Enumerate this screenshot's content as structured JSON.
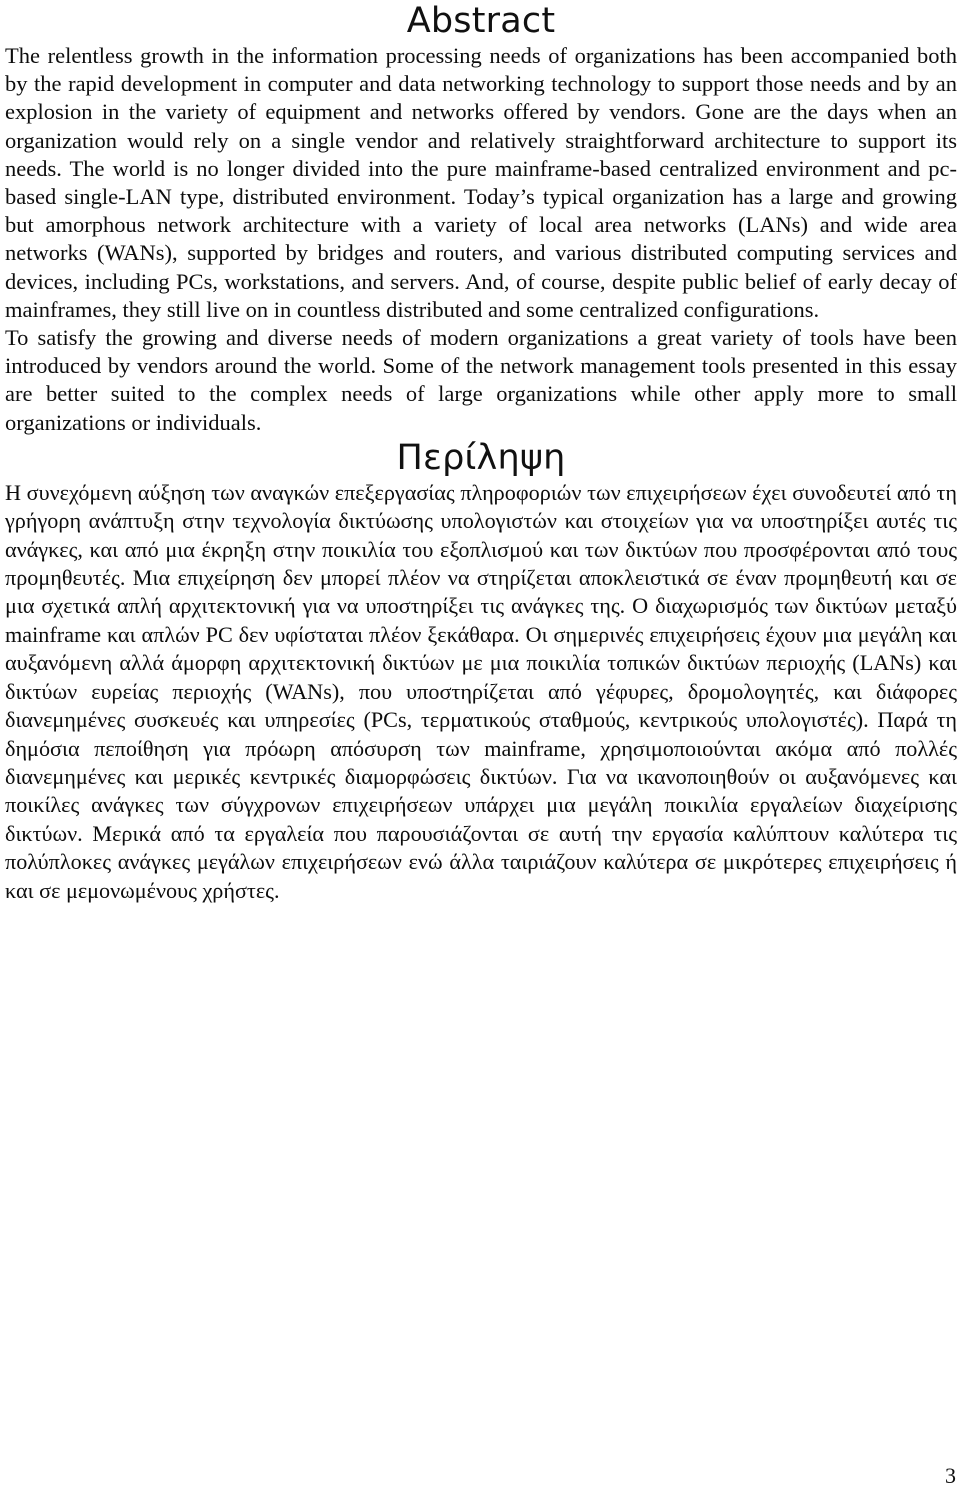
{
  "document": {
    "page_number": "3",
    "sections": [
      {
        "id": "abstract",
        "heading": "Abstract",
        "language": "en",
        "paragraphs": [
          "The relentless growth in the information processing needs of organizations has been accompanied both by the rapid development in computer and data networking technology to support those needs and by an explosion in the variety of equipment and networks offered by vendors. Gone are the days when an organization would rely on a single vendor and relatively straightforward architecture to support its needs. The world is no longer divided into the pure mainframe-based centralized environment and pc-based single-LAN type, distributed environment. Today’s typical organization has a large and growing but amorphous network architecture with a variety of local area networks (LANs) and wide area networks (WANs), supported by bridges and routers, and various distributed computing services and devices, including PCs, workstations, and servers. And, of course, despite public belief of early decay of mainframes, they still live on in countless distributed and some centralized configurations.",
          "To satisfy the growing and diverse needs of modern organizations a great variety of tools have been introduced by vendors around the world. Some of the network management tools presented in this essay are better suited to the complex needs of large organizations while other apply more to small organizations or individuals."
        ]
      },
      {
        "id": "perilipsi",
        "heading": "Περίληψη",
        "language": "el",
        "paragraphs": [
          "Η συνεχόμενη αύξηση των αναγκών επεξεργασίας πληροφοριών των επιχειρήσεων έχει συνοδευτεί από τη γρήγορη ανάπτυξη στην τεχνολογία δικτύωσης υπολογιστών και στοιχείων για να υποστηρίξει αυτές τις ανάγκες, και από μια έκρηξη στην ποικιλία του εξοπλισμού και των δικτύων που προσφέρονται από τους προμηθευτές. Μια επιχείρηση δεν μπορεί πλέον να στηρίζεται αποκλειστικά σε έναν προμηθευτή και σε μια σχετικά απλή αρχιτεκτονική για να υποστηρίξει τις ανάγκες της. Ο διαχωρισμός των δικτύων μεταξύ mainframe και απλών PC δεν υφίσταται πλέον ξεκάθαρα. Οι σημερινές επιχειρήσεις έχουν μια μεγάλη και αυξανόμενη αλλά άμορφη αρχιτεκτονική δικτύων με μια ποικιλία τοπικών δικτύων περιοχής (LANs) και δικτύων ευρείας περιοχής (WANs), που υποστηρίζεται από γέφυρες, δρομολογητές, και διάφορες διανεμημένες συσκευές και υπηρεσίες (PCs, τερματικούς σταθμούς, κεντρικούς υπολογιστές). Παρά τη δημόσια πεποίθηση για πρόωρη απόσυρση των mainframe, χρησιμοποιούνται ακόμα από πολλές διανεμημένες και μερικές κεντρικές διαμορφώσεις δικτύων. Για να ικανοποιηθούν οι αυξανόμενες και ποικίλες ανάγκες των σύγχρονων επιχειρήσεων υπάρχει μια μεγάλη ποικιλία εργαλείων διαχείρισης δικτύων. Μερικά από τα εργαλεία που παρουσιάζονται σε αυτή την εργασία καλύπτουν καλύτερα τις πολύπλοκες ανάγκες μεγάλων επιχειρήσεων ενώ άλλα ταιριάζουν καλύτερα σε μικρότερες επιχειρήσεις ή και σε μεμονωμένους χρήστες."
        ]
      }
    ]
  }
}
